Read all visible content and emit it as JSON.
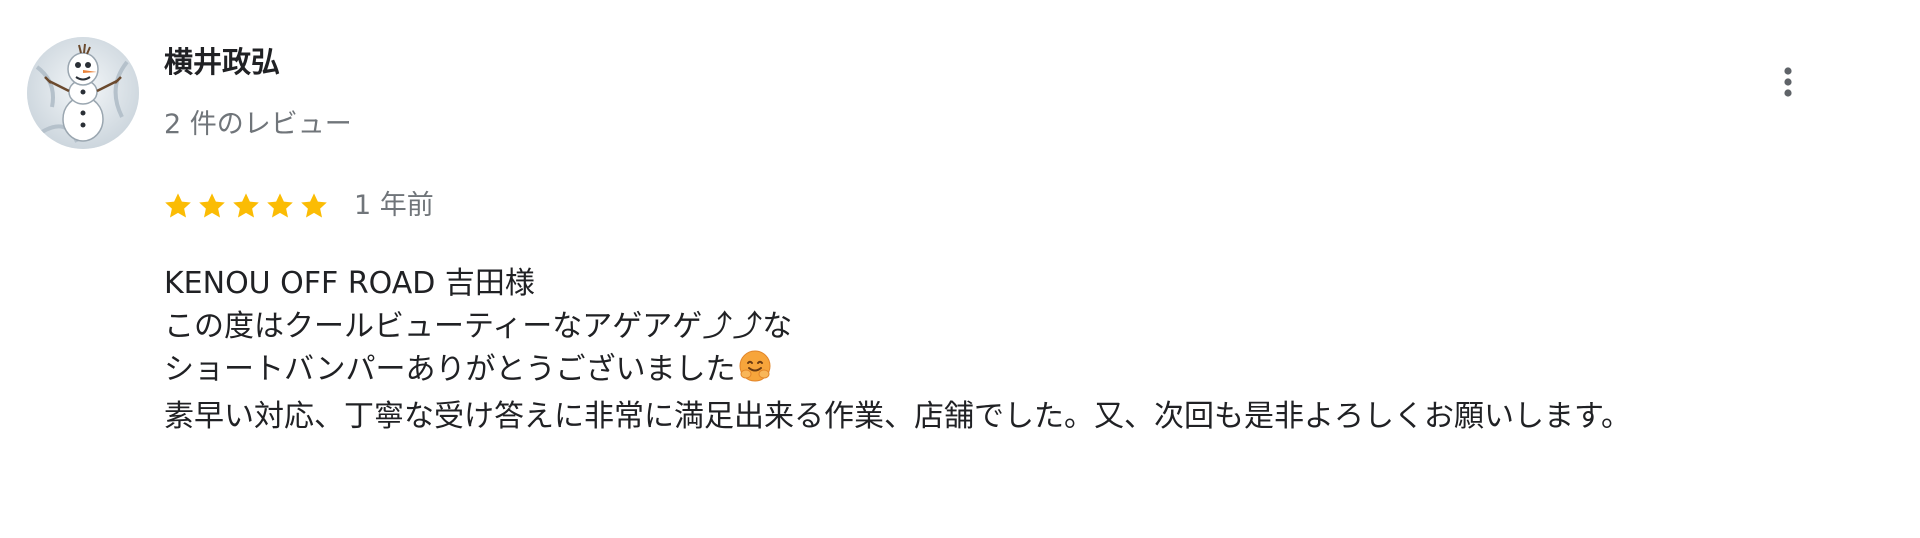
{
  "reviewer": {
    "name": "横井政弘",
    "review_count": "2 件のレビュー",
    "avatar_icon": "snowman-avatar-icon"
  },
  "menu": {
    "icon": "more-vert-icon"
  },
  "rating": {
    "stars": 5,
    "max_stars": 5,
    "star_color": "#fbbc04",
    "date": "1 年前"
  },
  "review": {
    "lines": [
      "KENOU OFF ROAD 吉田様",
      "この度はクールビューティーなアゲアゲ⤴︎⤴︎な",
      "ショートバンパーありがとうございました",
      "素早い対応、丁寧な受け答えに非常に満足出来る作業、店舗でした。又、次回も是非よろしくお願いします。"
    ],
    "emoji_icon": "hugging-face-emoji-icon"
  },
  "colors": {
    "primary_text": "#202124",
    "secondary_text": "#70757a",
    "star": "#fbbc04"
  }
}
